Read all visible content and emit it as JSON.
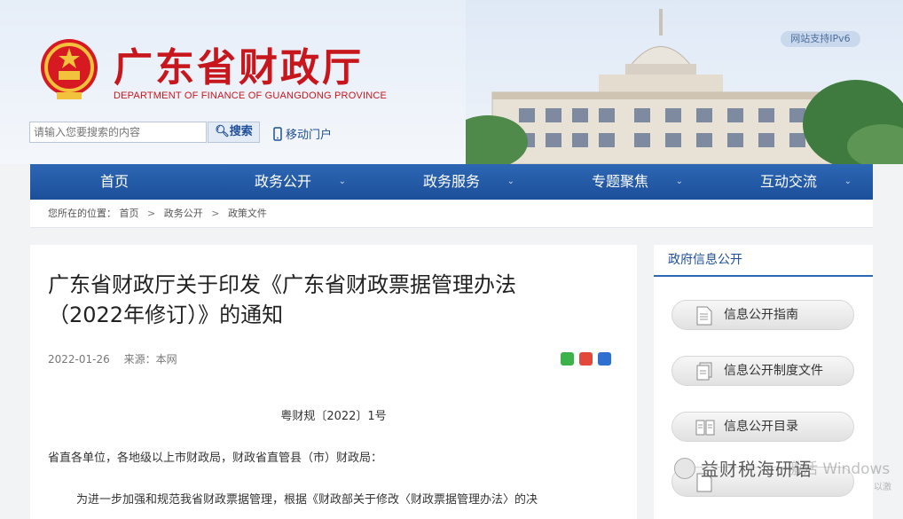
{
  "header": {
    "site_title": "广东省财政厅",
    "site_subtitle": "DEPARTMENT OF FINANCE OF GUANGDONG PROVINCE",
    "ipv6_badge": "网站支持IPv6",
    "search": {
      "placeholder": "请输入您要搜索的内容",
      "button_label": "搜索"
    },
    "mobile_link": "移动门户"
  },
  "nav": {
    "items": [
      {
        "label": "首页",
        "has_dropdown": false
      },
      {
        "label": "政务公开",
        "has_dropdown": true
      },
      {
        "label": "政务服务",
        "has_dropdown": true
      },
      {
        "label": "专题聚焦",
        "has_dropdown": true
      },
      {
        "label": "互动交流",
        "has_dropdown": true
      }
    ],
    "dropdown_glyph": "⌄"
  },
  "breadcrumb": {
    "prefix": "您所在的位置：",
    "items": [
      "首页",
      "政务公开",
      "政策文件"
    ],
    "separator": ">"
  },
  "article": {
    "title_line1": "广东省财政厅关于印发《广东省财政票据管理办法",
    "title_line2": "（2022年修订）》的通知",
    "date": "2022-01-26",
    "source": "来源：本网",
    "share_icons": [
      "wechat-icon",
      "weibo-icon",
      "qq-icon"
    ],
    "doc_number": "粤财规〔2022〕1号",
    "recipient": "省直各单位，各地级以上市财政局，财政省直管县（市）财政局：",
    "body_first_line": "为进一步加强和规范我省财政票据管理，根据《财政部关于修改〈财政票据管理办法〉的决"
  },
  "sidebar": {
    "title": "政府信息公开",
    "buttons": [
      {
        "label": "信息公开指南",
        "icon": "document-icon"
      },
      {
        "label": "信息公开制度文件",
        "icon": "documents-icon"
      },
      {
        "label": "信息公开目录",
        "icon": "catalog-icon"
      },
      {
        "label": "",
        "icon": "annual-report-icon"
      }
    ]
  },
  "overlay": {
    "watermark_text": "益财税海研语",
    "activate_windows": "激活 Windows",
    "activate_hint": "以激"
  },
  "colors": {
    "brand_red": "#c8161d",
    "nav_blue": "#1c4f9a",
    "link_blue": "#1e4f98"
  }
}
